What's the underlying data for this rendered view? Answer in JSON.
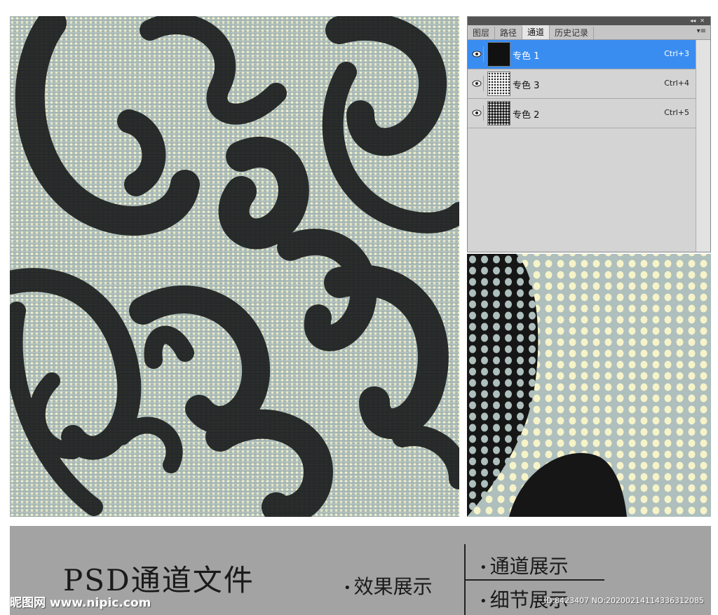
{
  "colors": {
    "pattern_bg": "#aebfbd",
    "dot_color": "#f3f1cc",
    "swirl_color": "#1d1f1f",
    "selected_row": "#3a8df0",
    "footer_bg": "#a3a3a3"
  },
  "panel": {
    "tabs": [
      {
        "label": "图层",
        "active": false
      },
      {
        "label": "路径",
        "active": false
      },
      {
        "label": "通道",
        "active": true
      },
      {
        "label": "历史记录",
        "active": false
      }
    ],
    "channels": [
      {
        "name": "专色 1",
        "shortcut": "Ctrl+3",
        "selected": true,
        "thumb": "solid-black"
      },
      {
        "name": "专色 3",
        "shortcut": "Ctrl+4",
        "selected": false,
        "thumb": "sparse-speckle"
      },
      {
        "name": "专色 2",
        "shortcut": "Ctrl+5",
        "selected": false,
        "thumb": "dense-speckle"
      }
    ],
    "icons": {
      "collapse": "double-left-arrow-icon",
      "close": "close-icon",
      "menu": "panel-menu-icon",
      "visibility": "eye-icon"
    }
  },
  "footer": {
    "title": "PSD通道文件",
    "effect_label": "效果展示",
    "channel_label": "通道展示",
    "detail_label": "细节展示",
    "watermark_site": "昵图网 www.nipic.com",
    "watermark_id": "ID:8423407 NO:20200214114336312085"
  }
}
